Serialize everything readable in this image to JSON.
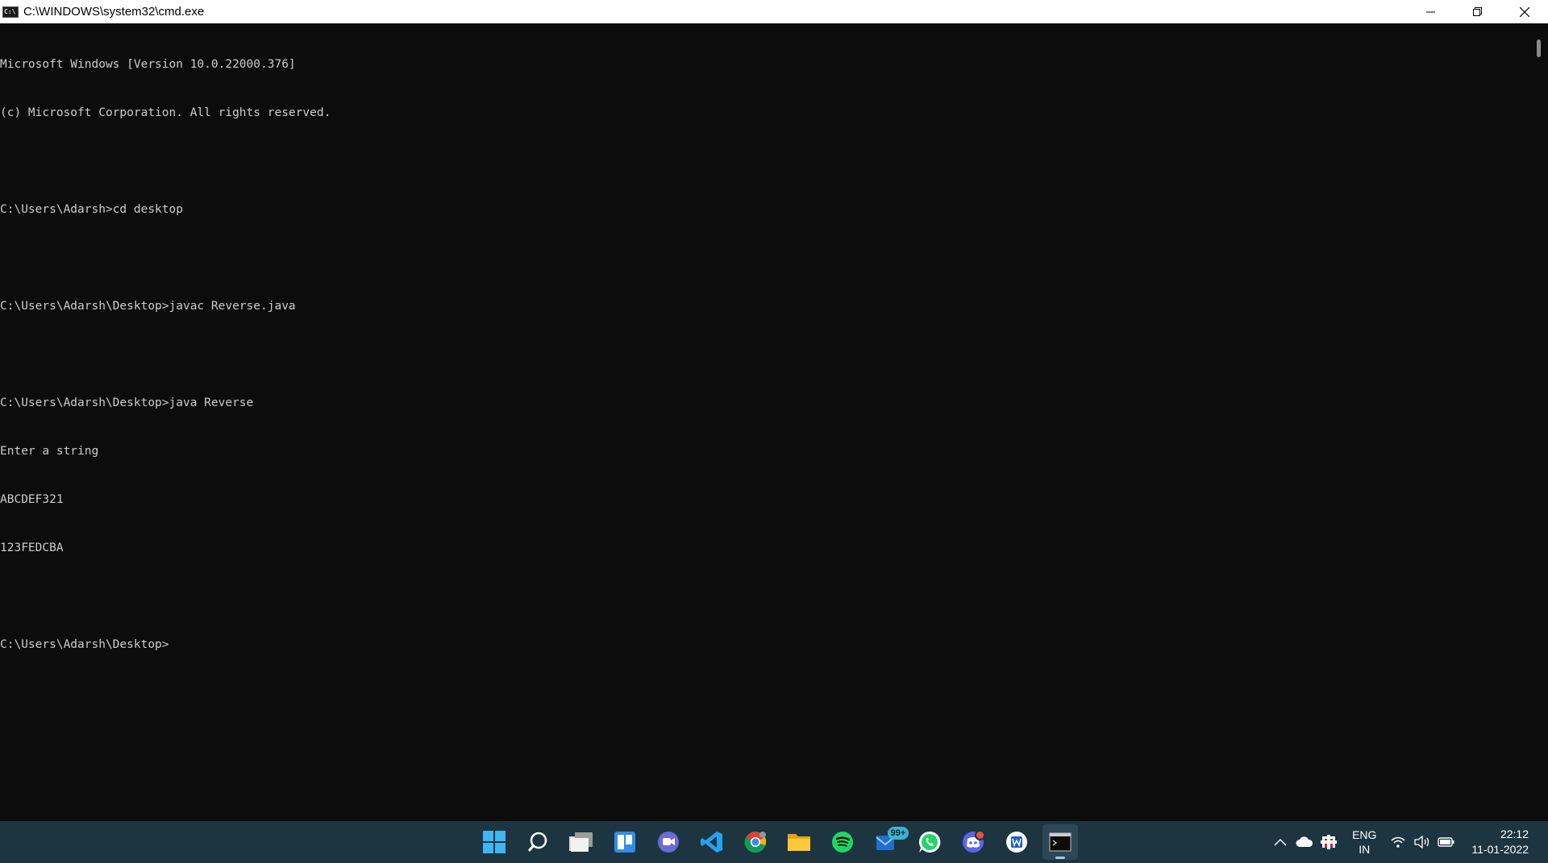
{
  "window": {
    "title": "C:\\WINDOWS\\system32\\cmd.exe",
    "controls": [
      "minimize",
      "restore",
      "close"
    ]
  },
  "console": {
    "lines": [
      "Microsoft Windows [Version 10.0.22000.376]",
      "(c) Microsoft Corporation. All rights reserved.",
      "",
      "C:\\Users\\Adarsh>cd desktop",
      "",
      "C:\\Users\\Adarsh\\Desktop>javac Reverse.java",
      "",
      "C:\\Users\\Adarsh\\Desktop>java Reverse",
      "Enter a string",
      "ABCDEF321",
      "123FEDCBA",
      "",
      "C:\\Users\\Adarsh\\Desktop>"
    ],
    "background": "#0c0c0c",
    "foreground": "#cccccc"
  },
  "taskbar": {
    "background": "#1d3541",
    "apps": [
      {
        "icon": "windows-start-icon"
      },
      {
        "icon": "search-icon"
      },
      {
        "icon": "task-view-icon"
      },
      {
        "icon": "widgets-icon"
      },
      {
        "icon": "teams-chat-icon"
      },
      {
        "icon": "vscode-icon"
      },
      {
        "icon": "chrome-icon"
      },
      {
        "icon": "file-explorer-icon"
      },
      {
        "icon": "spotify-icon"
      },
      {
        "icon": "mail-icon",
        "badge": "99+"
      },
      {
        "icon": "whatsapp-icon"
      },
      {
        "icon": "discord-icon"
      },
      {
        "icon": "word-app-icon"
      },
      {
        "icon": "terminal-icon",
        "active": true
      }
    ],
    "tray": {
      "language_top": "ENG",
      "language_bottom": "IN",
      "time": "22:12",
      "date": "11-01-2022"
    }
  }
}
